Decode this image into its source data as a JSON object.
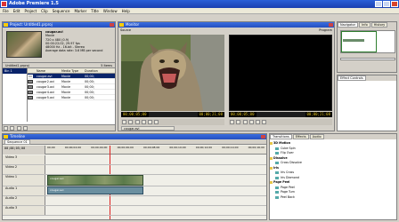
{
  "window": {
    "title": "Adobe Premiere 1.5"
  },
  "menu": [
    "File",
    "Edit",
    "Project",
    "Clip",
    "Sequence",
    "Marker",
    "Title",
    "Window",
    "Help"
  ],
  "project": {
    "title": "Project: Untitled1.prproj",
    "clip_name": "cougar.avi",
    "info": [
      "Movie",
      "720 x 480 (0.9)",
      "00:00:22;02, 29.97 fps",
      "48000 Hz - 16-bit - Stereo",
      "Average data rate: 3.6 MB per second"
    ],
    "bin_label": "Untitled1.prproj",
    "items_label": "5 Items",
    "columns": [
      "Name",
      "Media Type",
      "Duration"
    ],
    "rows": [
      {
        "name": "Bin 1",
        "type": "",
        "dur": ""
      },
      {
        "name": "cougar.avi",
        "type": "Movie",
        "dur": "00;00;"
      },
      {
        "name": "cougar2.avi",
        "type": "Movie",
        "dur": "00;00;"
      },
      {
        "name": "cougar3.avi",
        "type": "Movie",
        "dur": "00;00;"
      },
      {
        "name": "cougar4.avi",
        "type": "Movie",
        "dur": "00;00;"
      },
      {
        "name": "cougar5.avi",
        "type": "Movie",
        "dur": "00;00;"
      }
    ]
  },
  "monitor": {
    "title": "Monitor",
    "source_tab": "Source",
    "program_tab": "Program",
    "source_tc": "00;00;05;00",
    "source_dur": "00;00;21;08",
    "program_tc": "00;00;05;00",
    "program_dur": "00;00;21;08",
    "source_clip": "cougar.avi"
  },
  "navigator": {
    "tabs": [
      "Navigator",
      "Info",
      "History"
    ]
  },
  "effect_controls": {
    "title": "Effect Controls"
  },
  "timeline": {
    "title": "Timeline",
    "sequence_tab": "Sequence 01",
    "timecode": "00;00;05;00",
    "ruler": [
      "00;00",
      "00;00;02;00",
      "00;00;04;00",
      "00;00;06;00",
      "00;00;08;00",
      "00;00;10;00",
      "00;00;12;00",
      "00;00;14;00",
      "00;00;16;00"
    ],
    "tracks": [
      "Video 3",
      "Video 2",
      "Video 1",
      "Audio 1",
      "Audio 2",
      "Audio 3"
    ],
    "clip_label": "cougar.avi"
  },
  "effects": {
    "tabs": [
      "Transitions",
      "Effects",
      "Audio"
    ],
    "items": [
      {
        "label": "3D Motion",
        "folder": true
      },
      {
        "label": "Cube Spin",
        "folder": false
      },
      {
        "label": "Flip Over",
        "folder": false
      },
      {
        "label": "Dissolve",
        "folder": true
      },
      {
        "label": "Cross Dissolve",
        "folder": false
      },
      {
        "label": "Iris",
        "folder": true
      },
      {
        "label": "Iris Cross",
        "folder": false
      },
      {
        "label": "Iris Diamond",
        "folder": false
      },
      {
        "label": "Page Peel",
        "folder": true
      },
      {
        "label": "Page Peel",
        "folder": false
      },
      {
        "label": "Page Turn",
        "folder": false
      },
      {
        "label": "Peel Back",
        "folder": false
      }
    ]
  }
}
